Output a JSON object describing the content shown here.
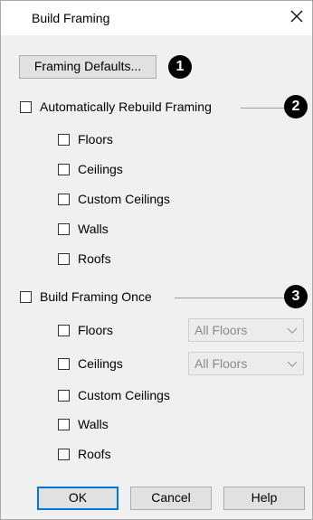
{
  "dialog": {
    "title": "Build Framing"
  },
  "framing_defaults_button": "Framing Defaults...",
  "callouts": [
    "1",
    "2",
    "3"
  ],
  "auto_rebuild": {
    "label": "Automatically Rebuild Framing",
    "checked": false,
    "items": [
      {
        "label": "Floors",
        "checked": false
      },
      {
        "label": "Ceilings",
        "checked": false
      },
      {
        "label": "Custom Ceilings",
        "checked": false
      },
      {
        "label": "Walls",
        "checked": false
      },
      {
        "label": "Roofs",
        "checked": false
      }
    ]
  },
  "build_once": {
    "label": "Build Framing Once",
    "checked": false,
    "items": [
      {
        "label": "Floors",
        "checked": false,
        "select": "All Floors"
      },
      {
        "label": "Ceilings",
        "checked": false,
        "select": "All Floors"
      },
      {
        "label": "Custom Ceilings",
        "checked": false
      },
      {
        "label": "Walls",
        "checked": false
      },
      {
        "label": "Roofs",
        "checked": false
      }
    ]
  },
  "buttons": {
    "ok": "OK",
    "cancel": "Cancel",
    "help": "Help"
  },
  "colors": {
    "focus_border": "#0078d7",
    "dialog_bg": "#f0f0f0"
  }
}
